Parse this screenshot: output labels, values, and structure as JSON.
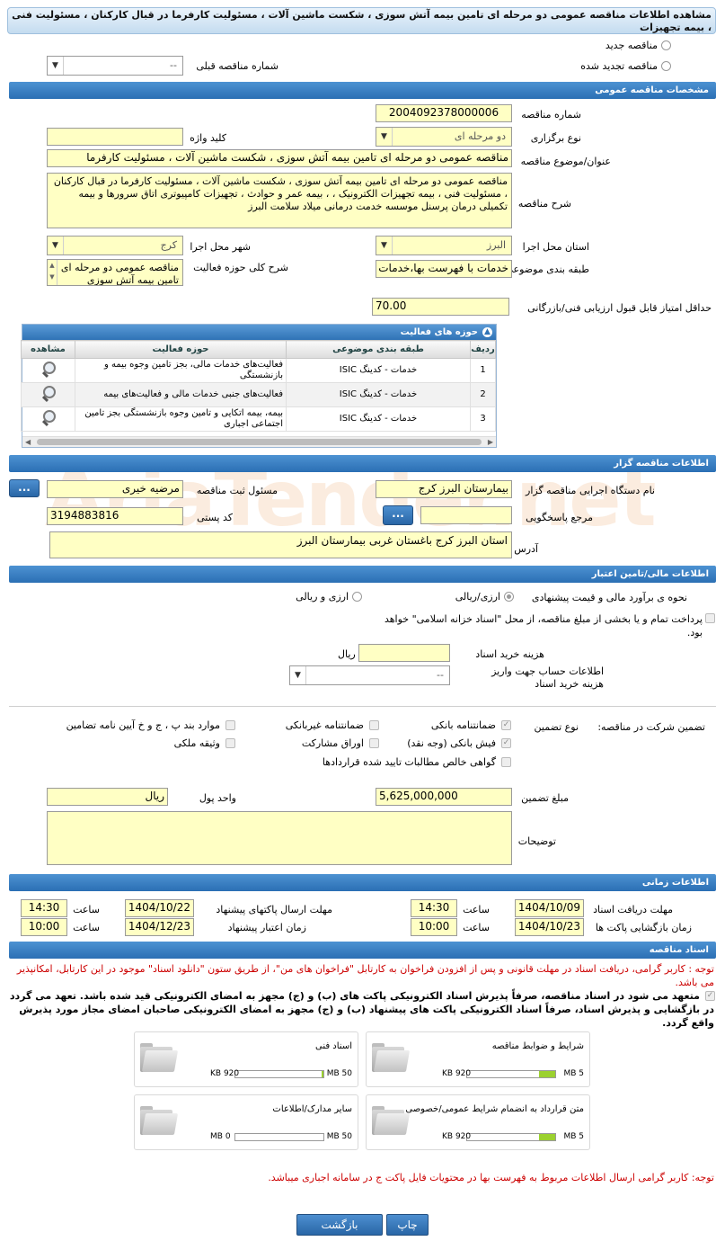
{
  "title": "مشاهده اطلاعات مناقصه عمومی دو مرحله ای تامین بیمه آتش سوزی ، شکست ماشین آلات ، مسئولیت کارفرما در قبال کارکنان ، مسئولیت فنی ، بیمه تجهیزات",
  "top": {
    "new_tender": "مناقصه جدید",
    "renewed_tender": "مناقصه تجدید شده",
    "prev_number_label": "شماره مناقصه قبلی",
    "prev_number_value": "--"
  },
  "sections": {
    "general": "مشخصات مناقصه عمومی",
    "organizer": "اطلاعات مناقصه گزار",
    "financial": "اطلاعات مالی/تامین اعتبار",
    "timing": "اطلاعات زمانی",
    "documents": "اسناد مناقصه"
  },
  "general": {
    "number_label": "شماره مناقصه",
    "number_value": "2004092378000006",
    "type_label": "نوع برگزاری",
    "type_value": "دو مرحله ای",
    "keyword_label": "کلید واژه",
    "keyword_value": "",
    "subject_label": "عنوان/موضوع مناقصه",
    "subject_value": "مناقصه عمومی دو مرحله ای  تامین بیمه آتش سوزی ، شکست ماشین آلات ، مسئولیت کارفرما",
    "desc_label": "شرح مناقصه",
    "desc_value": "مناقصه عمومی دو مرحله ای تامین بیمه آتش سوزی ، شکست ماشین آلات ، مسئولیت کارفرما در قبال کارکنان ، مسئولیت فنی ، بیمه تجهیزات الکترونیک ، ، بیمه عمر و حوادث ، تجهیزات کامپیوتری اتاق سرورها و بیمه تکمیلی درمان پرسنل موسسه خدمت درمانی میلاد سلامت البرز",
    "province_label": "استان محل اجرا",
    "province_value": "البرز",
    "city_label": "شهر محل اجرا",
    "city_value": "کرج",
    "category_label": "طبقه بندی موضوعی",
    "category_value": "خدمات با فهرست بها،خدمات",
    "scope_label": "شرح کلی حوزه فعالیت",
    "scope_value": "مناقصه عمومی دو مرحله ای تامین بیمه آتش سوزی",
    "min_score_label": "حداقل امتیاز قابل قبول ارزیابی فنی/بازرگانی",
    "min_score_value": "70.00"
  },
  "activity_grid": {
    "title": "حوزه های فعالیت",
    "columns": [
      "ردیف",
      "طبقه بندی موضوعی",
      "حوزه فعالیت",
      "مشاهده"
    ],
    "rows": [
      {
        "idx": "1",
        "category": "خدمات - کدینگ ISIC",
        "area": "فعالیت‌های خدمات مالی، بجز تامین وجوه بیمه و بازنشستگی"
      },
      {
        "idx": "2",
        "category": "خدمات - کدینگ ISIC",
        "area": "فعالیت‌های جنبی خدمات مالی و فعالیت‌های بیمه"
      },
      {
        "idx": "3",
        "category": "خدمات - کدینگ ISIC",
        "area": "بیمه، بیمه اتکایی و تامین وجوه بازنشستگی بجز تامین اجتماعی اجباری"
      }
    ]
  },
  "organizer": {
    "org_label": "نام دستگاه اجرایی مناقصه گزار",
    "org_value": "بیمارستان البرز کرج",
    "responsible_label": "مسئول ثبت مناقصه",
    "responsible_value": "مرضیه خیری",
    "ref_label": "مرجع پاسخگویی",
    "ref_value": "",
    "postal_label": "کد پستی",
    "postal_value": "3194883816",
    "address_label": "آدرس",
    "address_value": "استان البرز کرج باغستان غربی بیمارستان البرز",
    "dots": "..."
  },
  "financial": {
    "estimate_label": "نحوه ی برآورد مالی و قیمت پیشنهادی",
    "opt_currency": "ارزی/ریالی",
    "opt_currency_rial": "ارزی و ریالی",
    "treasury_text": "پرداخت تمام و یا بخشی از مبلغ مناقصه، از محل \"اسناد خزانه اسلامی\" خواهد بود.",
    "doc_cost_label": "هزینه خرید اسناد",
    "doc_cost_unit": "ریال",
    "doc_cost_value": "",
    "account_label": "اطلاعات حساب جهت واریز هزینه خرید اسناد",
    "account_value": "--"
  },
  "guarantee": {
    "label": "تضمین شرکت در مناقصه:",
    "type_label": "نوع تضمین",
    "items": {
      "bank_guarantee": "ضمانتنامه بانکی",
      "non_bank_guarantee": "ضمانتنامه غیربانکی",
      "bylaw_items": "موارد بند پ ، ج و خ آیین نامه تضامین",
      "bank_receipt": "فیش بانکی (وجه نقد)",
      "participation_bonds": "اوراق مشارکت",
      "property_bond": "وثیقه ملکی",
      "net_claims": "گواهی خالص مطالبات تایید شده قراردادها"
    },
    "amount_label": "مبلغ تضمین",
    "amount_value": "5,625,000,000",
    "currency_label": "واحد پول",
    "currency_value": "ریال",
    "notes_label": "توضیحات",
    "notes_value": ""
  },
  "timing": {
    "receive_deadline_label": "مهلت دریافت اسناد",
    "receive_deadline_date": "1404/10/09",
    "time_label": "ساعت",
    "receive_deadline_time": "14:30",
    "submit_deadline_label": "مهلت ارسال پاکتهای پیشنهاد",
    "submit_deadline_date": "1404/10/22",
    "submit_deadline_time": "14:30",
    "opening_label": "زمان بازگشایی پاکت ها",
    "opening_date": "1404/10/23",
    "opening_time": "10:00",
    "validity_label": "زمان اعتبار پیشنهاد",
    "validity_date": "1404/12/23",
    "validity_time": "10:00"
  },
  "documents": {
    "notice": "توجه : کاربر گرامی، دریافت اسناد در مهلت قانونی و پس از افزودن فراخوان به کارتابل \"فراخوان های من\"، از طریق ستون \"دانلود اسناد\" موجود در این کارتابل، امکانپذیر می باشد.",
    "commitment": "متعهد می شود در اسناد مناقصه، صرفاً پذیرش اسناد الکترونیکی پاکت های (ب) و (ج) مجهز به امضای الکترونیکی قید شده باشد. تعهد می گردد در بازگشایی و پذیرش اسناد، صرفاً اسناد الکترونیکی پاکت های پیشنهاد (ب) و (ج) مجهز به امضای الکترونیکی صاحبان امضای مجاز مورد پذیرش واقع گردد.",
    "files": [
      {
        "name": "شرایط و ضوابط مناقصه",
        "max": "5 MB",
        "size": "920 KB",
        "fill": 0.18
      },
      {
        "name": "اسناد فنی",
        "max": "50 MB",
        "size": "920 KB",
        "fill": 0.02
      },
      {
        "name": "متن قرارداد به انضمام شرایط عمومی/خصوصی",
        "max": "5 MB",
        "size": "920 KB",
        "fill": 0.18
      },
      {
        "name": "سایر مدارک/اطلاعات",
        "max": "50 MB",
        "size": "0 MB",
        "fill": 0
      }
    ],
    "footer_notice": "توجه: کاربر گرامی ارسال اطلاعات مربوط به فهرست بها در محتویات فایل پاکت ج در سامانه اجباری میباشد."
  },
  "buttons": {
    "print": "چاپ",
    "back": "بازگشت"
  },
  "watermark": "AriaTender.net"
}
